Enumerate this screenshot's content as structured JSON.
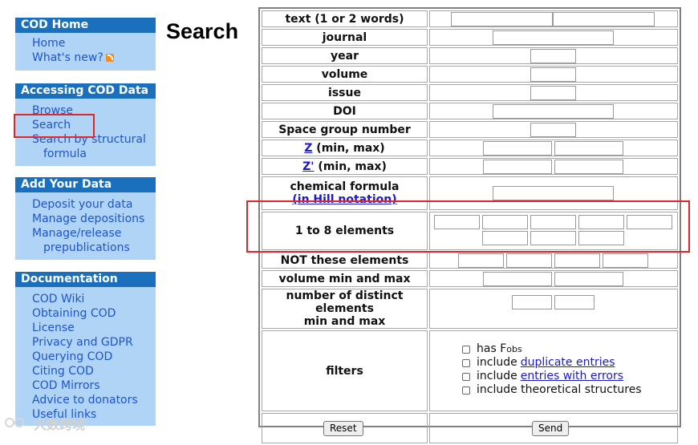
{
  "sidebar": {
    "home": {
      "header": "COD Home",
      "items": [
        "Home",
        "What's new?"
      ]
    },
    "access": {
      "header": "Accessing COD Data",
      "items": [
        "Browse",
        "Search",
        "Search by structural formula"
      ]
    },
    "add": {
      "header": "Add Your Data",
      "items": [
        "Deposit your data",
        "Manage depositions",
        "Manage/release prepublications"
      ]
    },
    "docs": {
      "header": "Documentation",
      "items": [
        "COD Wiki",
        "Obtaining COD",
        "License",
        "Privacy and GDPR",
        "Querying COD",
        "Citing COD",
        "COD Mirrors",
        "Advice to donators",
        "Useful links"
      ]
    }
  },
  "page_title": "Search",
  "form": {
    "text": "text (1 or 2 words)",
    "journal": "journal",
    "year": "year",
    "volume": "volume",
    "issue": "issue",
    "doi": "DOI",
    "space_group": "Space group number",
    "z_link": "Z",
    "z_suffix": " (min, max)",
    "zp_link": "Z'",
    "zp_suffix": " (min, max)",
    "formula_line1": "chemical formula",
    "formula_line2": "(in Hill notation)",
    "elements": "1 to 8 elements",
    "not_elements": "NOT these elements",
    "vol_minmax": "volume min and max",
    "distinct_line1": "number of distinct elements",
    "distinct_line2": "min and max",
    "filters_label": "filters",
    "filter_has": "has F",
    "filter_has_sub": "obs",
    "filter_include": "include",
    "filter_dup_link": "duplicate entries",
    "filter_err_link": "entries with errors",
    "filter_theory": "include theoretical structures",
    "reset": "Reset",
    "send": "Send"
  },
  "watermark": "大数跨境",
  "colors": {
    "nav_header": "#1a70bd",
    "nav_bg": "#b0d4f6",
    "link": "#1f55c8",
    "highlight": "#e0262a"
  }
}
